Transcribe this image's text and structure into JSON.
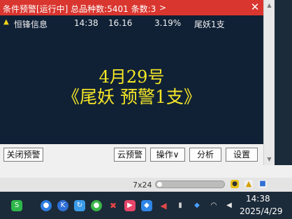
{
  "window": {
    "title": "条件预警[运行中] 总品种数:5401 条数:3",
    "title_arrow": ">",
    "close_glyph": "✕"
  },
  "alerts": [
    {
      "icon": "alert-up-icon",
      "name": "恒锋信息",
      "time": "14:38",
      "price": "16.16",
      "change": "3.19%",
      "condition": "尾妖1支"
    }
  ],
  "banner": {
    "line1": "4月29号",
    "line2": "《尾妖 预警1支》"
  },
  "toolbar": {
    "close_alert": "关闭预警",
    "cloud_alert": "云预警",
    "operate": "操作∨",
    "analyze": "分析",
    "settings": "设置"
  },
  "statusbar": {
    "dimensions": "7x24"
  },
  "clock": {
    "time": "14:38",
    "date": "2025/4/29"
  },
  "colors": {
    "title_bar": "#d9362f",
    "panel_bg": "#102136",
    "banner_text": "#f5e626",
    "taskbar_bg": "#1c2b3a"
  }
}
